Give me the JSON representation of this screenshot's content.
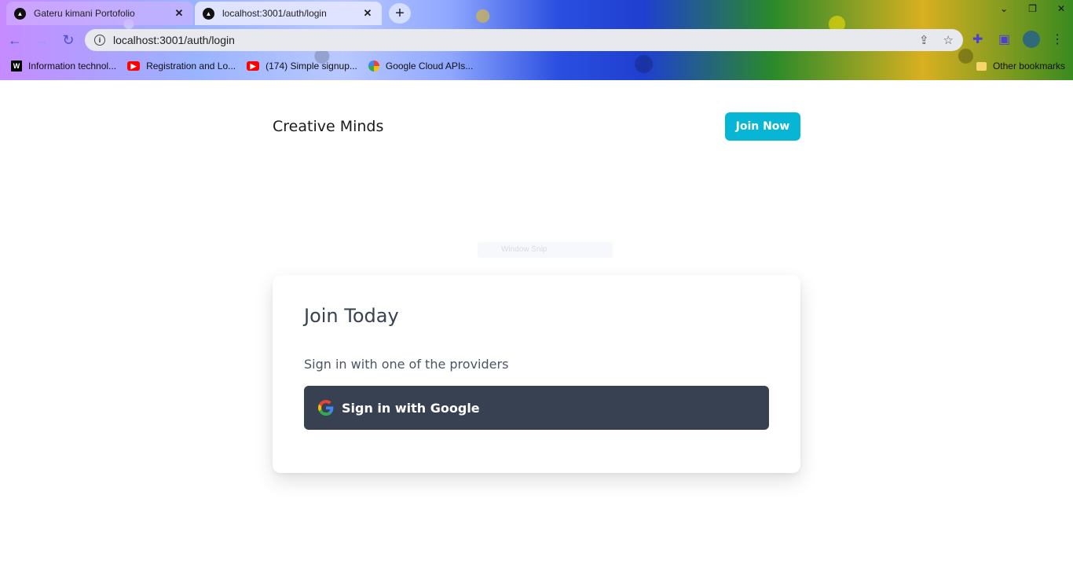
{
  "browser": {
    "tabs": [
      {
        "title": "Gateru kimani Portofolio",
        "active": false
      },
      {
        "title": "localhost:3001/auth/login",
        "active": true
      }
    ],
    "address": "localhost:3001/auth/login",
    "bookmarks": [
      {
        "label": "Information technol...",
        "icon": "wikipedia-icon"
      },
      {
        "label": "Registration and Lo...",
        "icon": "youtube-icon"
      },
      {
        "label": "(174) Simple signup...",
        "icon": "youtube-icon"
      },
      {
        "label": "Google Cloud APIs...",
        "icon": "google-cloud-icon"
      }
    ],
    "other_bookmarks": "Other bookmarks"
  },
  "nav": {
    "brand": "Creative Minds",
    "join_button": "Join Now"
  },
  "ghost_text": "Window Snip",
  "card": {
    "title": "Join Today",
    "subtitle": "Sign in with one of the providers",
    "google_button": "Sign in with Google"
  },
  "colors": {
    "accent": "#06b6d4",
    "button_dark": "#374151",
    "heading": "#374151"
  }
}
